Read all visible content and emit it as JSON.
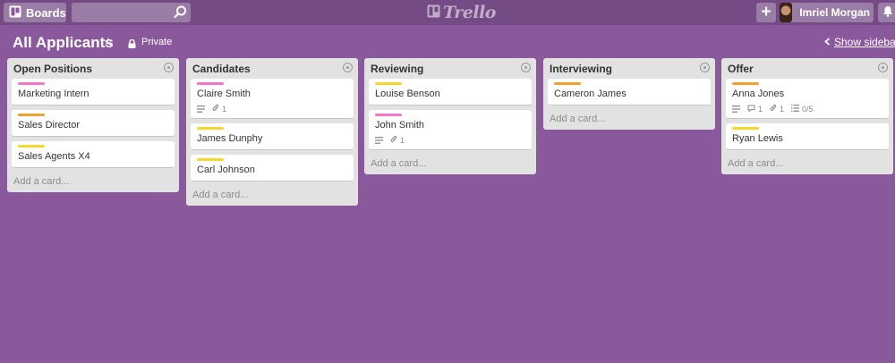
{
  "header": {
    "boards_label": "Boards",
    "search": {
      "value": "",
      "placeholder": ""
    },
    "logo_text": "Trello",
    "add_label": "+",
    "user_name": "Imriel Morgan",
    "icons": [
      "boards-icon",
      "search-icon",
      "logo-icon",
      "plus-icon",
      "avatar",
      "bell-icon"
    ]
  },
  "board": {
    "title": "All Applicants",
    "privacy": "Private",
    "show_sidebar": "Show sidebar"
  },
  "colors": {
    "background": "#8a599c",
    "header": "#744b85",
    "label_pink": "#f375c6",
    "label_orange": "#f2a02d",
    "label_yellow": "#f5d730"
  },
  "lists": [
    {
      "title": "Open Positions",
      "add_card": "Add a card...",
      "cards": [
        {
          "title": "Marketing Intern",
          "label": "pink"
        },
        {
          "title": "Sales Director",
          "label": "orange"
        },
        {
          "title": "Sales Agents X4",
          "label": "yellow"
        }
      ]
    },
    {
      "title": "Candidates",
      "add_card": "Add a card...",
      "cards": [
        {
          "title": "Claire Smith",
          "label": "pink",
          "attachments": "1",
          "has_description": true
        },
        {
          "title": "James Dunphy",
          "label": "yellow"
        },
        {
          "title": "Carl Johnson",
          "label": "yellow"
        }
      ]
    },
    {
      "title": "Reviewing",
      "add_card": "Add a card...",
      "cards": [
        {
          "title": "Louise Benson",
          "label": "yellow"
        },
        {
          "title": "John Smith",
          "label": "pink",
          "attachments": "1",
          "has_description": true
        }
      ]
    },
    {
      "title": "Interviewing",
      "add_card": "Add a card...",
      "cards": [
        {
          "title": "Cameron James",
          "label": "orange"
        }
      ]
    },
    {
      "title": "Offer",
      "add_card": "Add a card...",
      "cards": [
        {
          "title": "Anna Jones",
          "label": "orange",
          "comments": "1",
          "attachments": "1",
          "checklist": "0/5",
          "has_description": true
        },
        {
          "title": "Ryan Lewis",
          "label": "yellow"
        }
      ]
    }
  ]
}
